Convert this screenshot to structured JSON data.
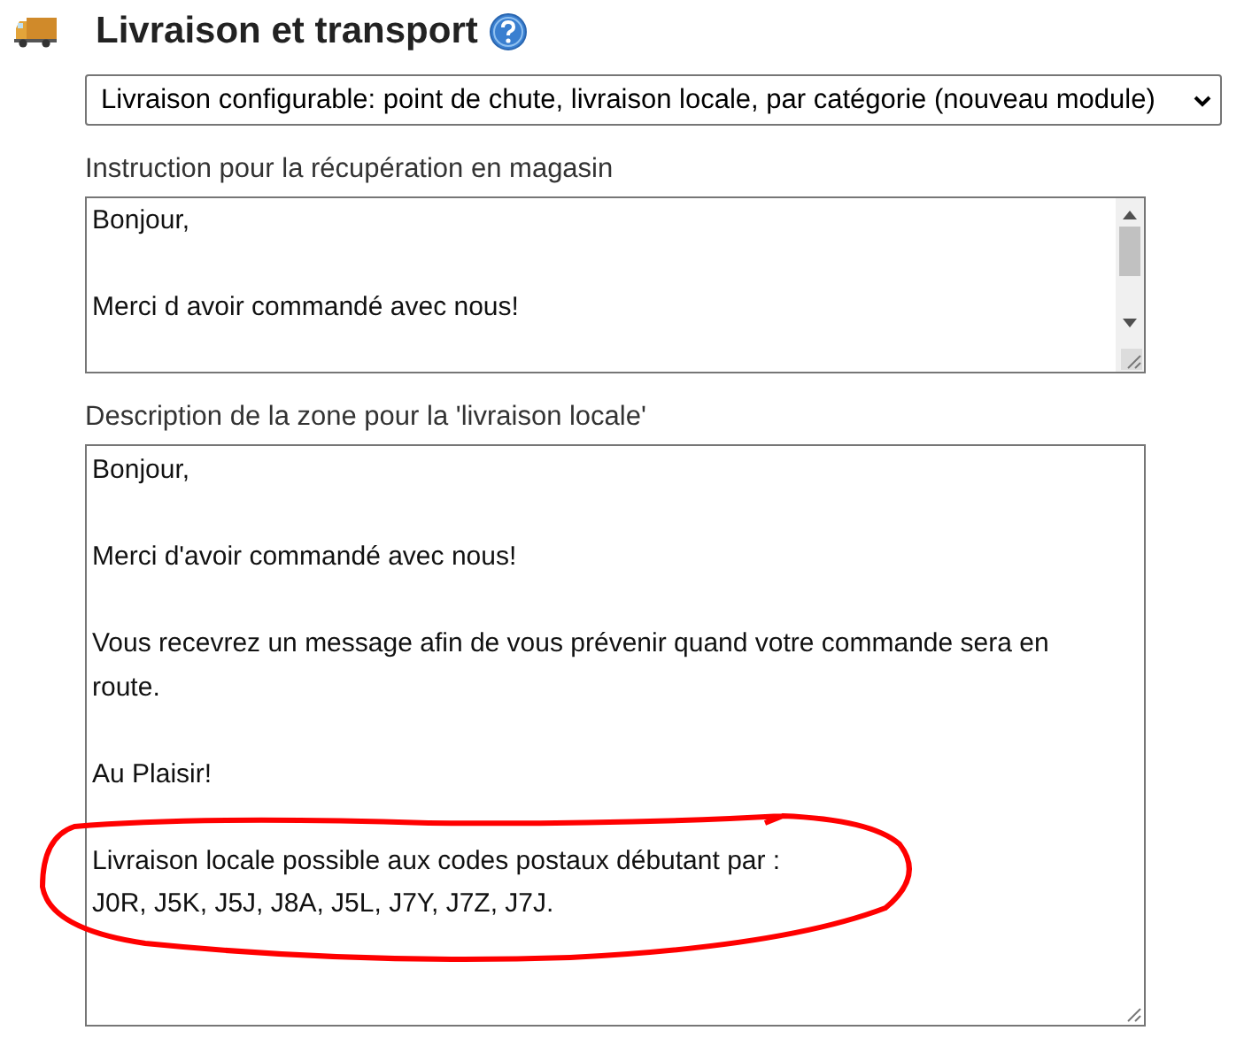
{
  "section": {
    "title": "Livraison et transport"
  },
  "shipping_select": {
    "value": "Livraison configurable: point de chute, livraison locale, par catégorie (nouveau module)"
  },
  "pickup_instruction": {
    "label": "Instruction pour la récupération en magasin",
    "paragraphs": [
      {
        "text": "Bonjour,",
        "circled": false
      },
      {
        "text": "Merci d avoir commandé avec nous!",
        "circled": false
      }
    ]
  },
  "local_zone_description": {
    "label": "Description de la zone pour la 'livraison locale'",
    "paragraphs": [
      {
        "text": "Bonjour,",
        "circled": false
      },
      {
        "text": "Merci d'avoir commandé avec nous!",
        "circled": false
      },
      {
        "text": "Vous recevrez un message afin de vous prévenir quand votre commande sera en route.",
        "circled": false
      },
      {
        "text": "Au Plaisir!",
        "circled": false
      },
      {
        "text": "Livraison locale possible aux codes postaux débutant par :\nJ0R, J5K, J5J, J8A, J5L, J7Y, J7Z, J7J.",
        "circled": true
      }
    ]
  }
}
